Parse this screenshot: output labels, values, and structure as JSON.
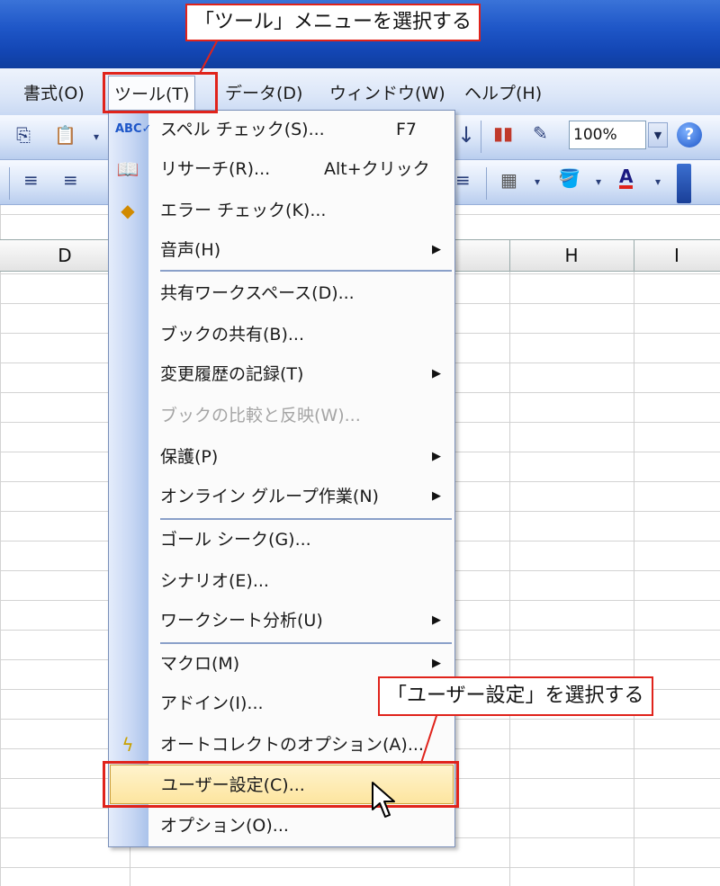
{
  "menubar": {
    "items": [
      {
        "label": "書式(O)"
      },
      {
        "label": "ツール(T)"
      },
      {
        "label": "データ(D)"
      },
      {
        "label": "ウィンドウ(W)"
      },
      {
        "label": "ヘルプ(H)"
      }
    ]
  },
  "toolbar": {
    "zoom_value": "100%",
    "help_symbol": "?"
  },
  "sheet": {
    "columns": [
      {
        "label": "D"
      },
      {
        "label": "H"
      },
      {
        "label": "I"
      }
    ]
  },
  "dropdown": {
    "items": [
      {
        "label": "スペル チェック(S)...",
        "shortcut": "F7",
        "icon": "spell-check-icon"
      },
      {
        "label": "リサーチ(R)...",
        "shortcut": "Alt+クリック",
        "icon": "research-icon"
      },
      {
        "label": "エラー チェック(K)...",
        "icon": "error-check-icon"
      },
      {
        "label": "音声(H)",
        "submenu": true
      },
      {
        "label": "共有ワークスペース(D)..."
      },
      {
        "label": "ブックの共有(B)..."
      },
      {
        "label": "変更履歴の記録(T)",
        "submenu": true
      },
      {
        "label": "ブックの比較と反映(W)...",
        "disabled": true
      },
      {
        "label": "保護(P)",
        "submenu": true
      },
      {
        "label": "オンライン グループ作業(N)",
        "submenu": true
      },
      {
        "label": "ゴール シーク(G)..."
      },
      {
        "label": "シナリオ(E)..."
      },
      {
        "label": "ワークシート分析(U)",
        "submenu": true
      },
      {
        "label": "マクロ(M)",
        "submenu": true
      },
      {
        "label": "アドイン(I)..."
      },
      {
        "label": "オートコレクトのオプション(A)...",
        "icon": "autocorrect-icon"
      },
      {
        "label": "ユーザー設定(C)...",
        "highlighted": true
      },
      {
        "label": "オプション(O)..."
      }
    ]
  },
  "annotations": {
    "top_callout": "「ツール」メニューを選択する",
    "bottom_callout": "「ユーザー設定」を選択する"
  },
  "colors": {
    "annotation_red": "#e0231b",
    "highlight": "#fde59f",
    "title_blue": "#1f57c8"
  }
}
